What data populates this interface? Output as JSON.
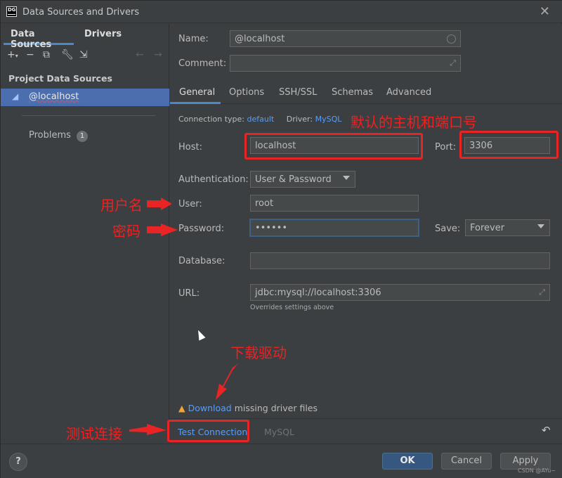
{
  "window": {
    "title": "Data Sources and Drivers",
    "app_icon": "DG"
  },
  "left": {
    "tabs": [
      "Data Sources",
      "Drivers"
    ],
    "section": "Project Data Sources",
    "item": "@localhost",
    "problems_label": "Problems",
    "problems_count": "1"
  },
  "form": {
    "name_label": "Name:",
    "name_value": "@localhost",
    "comment_label": "Comment:",
    "comment_value": "",
    "tabs": [
      "General",
      "Options",
      "SSH/SSL",
      "Schemas",
      "Advanced"
    ],
    "conn_type_label": "Connection type:",
    "conn_type_value": "default",
    "driver_label": "Driver:",
    "driver_value": "MySQL",
    "host_label": "Host:",
    "host_value": "localhost",
    "port_label": "Port:",
    "port_value": "3306",
    "auth_label": "Authentication:",
    "auth_value": "User & Password",
    "user_label": "User:",
    "user_value": "root",
    "password_label": "Password:",
    "password_value": "••••••",
    "save_label": "Save:",
    "save_value": "Forever",
    "database_label": "Database:",
    "database_value": "",
    "url_label": "URL:",
    "url_value": "jdbc:mysql://localhost:3306",
    "url_hint": "Overrides settings above"
  },
  "warning": {
    "link": "Download",
    "text": " missing driver files"
  },
  "bottom": {
    "test_connection": "Test Connection",
    "driver_name": "MySQL"
  },
  "footer": {
    "help": "?",
    "ok": "OK",
    "cancel": "Cancel",
    "apply": "Apply"
  },
  "annotations": {
    "host_port": "默认的主机和端口号",
    "user": "用户名",
    "password": "密码",
    "download": "下载驱动",
    "test": "测试连接"
  },
  "watermark": "CSDN @AYu~",
  "colors": {
    "accent": "#4a88c7",
    "selection": "#4b6eaf",
    "annotation": "#e82424",
    "link": "#589df6",
    "warning": "#f0a732"
  }
}
